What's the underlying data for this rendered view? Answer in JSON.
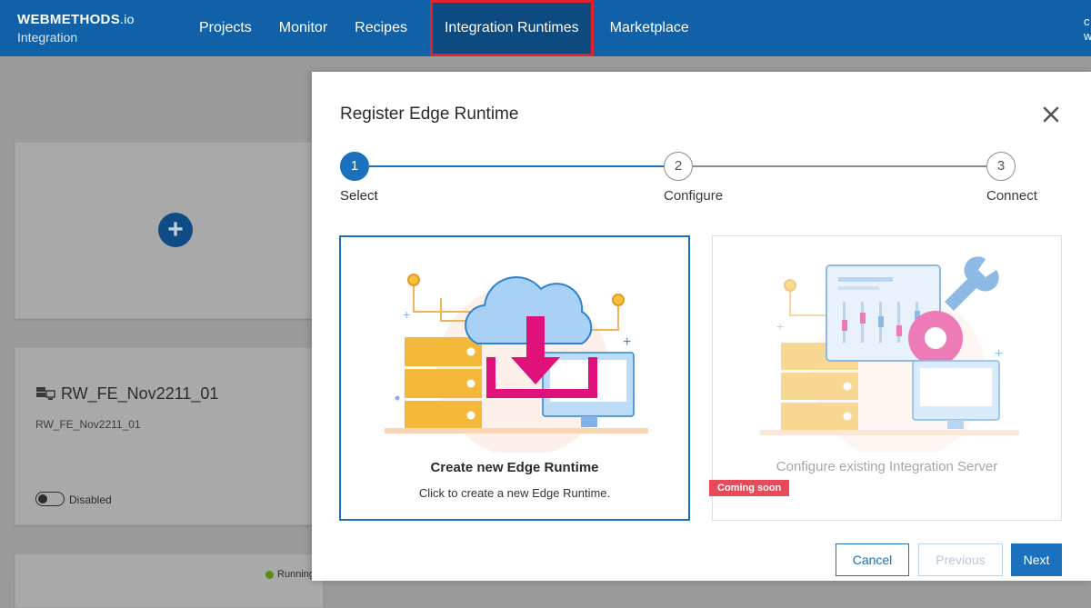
{
  "header": {
    "brand_name": "WEBMETHODS",
    "brand_suffix": ".io",
    "brand_sub": "Integration",
    "nav": [
      {
        "label": "Projects"
      },
      {
        "label": "Monitor"
      },
      {
        "label": "Recipes"
      },
      {
        "label": "Integration Runtimes",
        "active": true
      },
      {
        "label": "Marketplace"
      }
    ],
    "user_partial": "c w"
  },
  "background": {
    "runtime_card": {
      "title": "RW_FE_Nov2211_01",
      "subtitle": "RW_FE_Nov2211_01",
      "toggle_label": "Disabled",
      "icon": "server-icon"
    },
    "third_card_status": "Running"
  },
  "modal": {
    "title": "Register Edge Runtime",
    "close_icon": "close-icon",
    "steps": [
      {
        "number": "1",
        "label": "Select",
        "state": "active"
      },
      {
        "number": "2",
        "label": "Configure",
        "state": "pending"
      },
      {
        "number": "3",
        "label": "Connect",
        "state": "pending"
      }
    ],
    "options": [
      {
        "title": "Create new Edge Runtime",
        "description": "Click to create a new Edge Runtime.",
        "selected": true
      },
      {
        "title": "Configure existing Integration Server",
        "badge": "Coming soon",
        "disabled": true
      }
    ],
    "buttons": {
      "cancel": "Cancel",
      "previous": "Previous",
      "next": "Next"
    }
  },
  "colors": {
    "nav_bg": "#1061a8",
    "accent": "#1b71bd",
    "highlight_box": "#e3202c",
    "badge": "#e94a5a",
    "server_yellow": "#f4b83a",
    "download_magenta": "#e0117a"
  }
}
